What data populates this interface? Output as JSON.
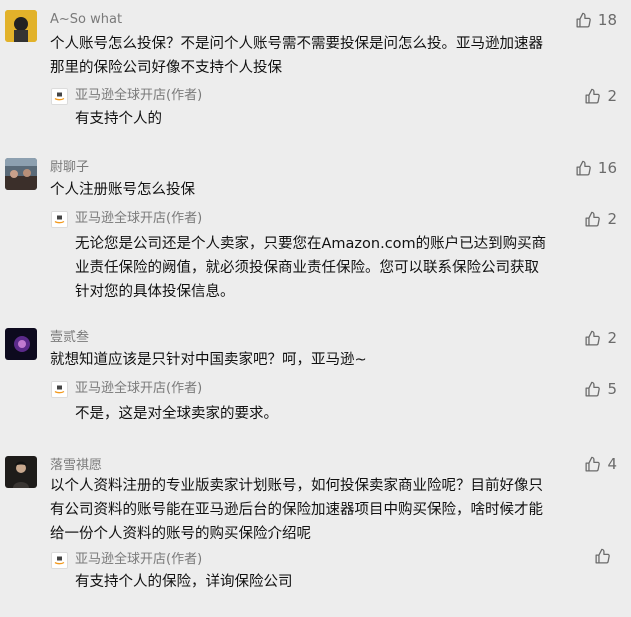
{
  "comments": [
    {
      "author": "A~So what",
      "likes": "18",
      "text_lines": [
        "个人账号怎么投保？不是问个人账号需不需要投保是问怎么投。亚马逊加速器",
        "那里的保险公司好像不支持个人投保"
      ],
      "reply": {
        "author": "亚马逊全球开店(作者)",
        "likes": "2",
        "text_lines": [
          "有支持个人的"
        ]
      }
    },
    {
      "author": "尉聊子",
      "likes": "16",
      "text_lines": [
        "个人注册账号怎么投保"
      ],
      "reply": {
        "author": "亚马逊全球开店(作者)",
        "likes": "2",
        "text_lines": [
          "无论您是公司还是个人卖家，只要您在Amazon.com的账户已达到购买商",
          "业责任保险的阙值，就必须投保商业责任保险。您可以联系保险公司获取",
          "针对您的具体投保信息。"
        ]
      }
    },
    {
      "author": "壹贰叁",
      "likes": "2",
      "text_lines": [
        "就想知道应该是只针对中国卖家吧？呵，亚马逊~"
      ],
      "reply": {
        "author": "亚马逊全球开店(作者)",
        "likes": "5",
        "text_lines": [
          "不是，这是对全球卖家的要求。"
        ]
      }
    },
    {
      "author": "落雪祺愿",
      "likes": "4",
      "text_lines": [
        "以个人资料注册的专业版卖家计划账号，如何投保卖家商业险呢？目前好像只",
        "有公司资料的账号能在亚马逊后台的保险加速器项目中购买保险，啥时候才能",
        "给一份个人资料的账号的购买保险介绍呢"
      ],
      "reply": {
        "author": "亚马逊全球开店(作者)",
        "likes": "",
        "text_lines": [
          "有支持个人的保险，详询保险公司"
        ]
      }
    }
  ],
  "colors": {
    "background": "#ededed",
    "meta_text": "#7a7a7a",
    "body_text": "#111111"
  },
  "icons": {
    "like": "thumbs-up-icon",
    "author_badge": "amazon-global-selling-logo"
  }
}
